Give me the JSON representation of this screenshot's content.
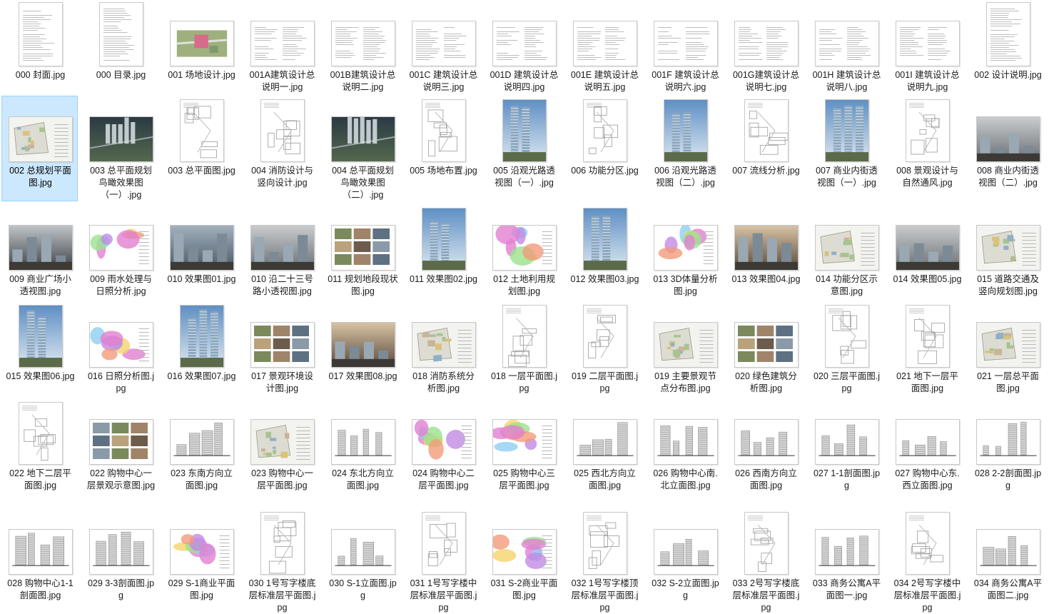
{
  "files": [
    {
      "name": "000 封面.jpg",
      "kind": "doc"
    },
    {
      "name": "000 目录.jpg",
      "kind": "doc"
    },
    {
      "name": "001 场地设计.jpg",
      "kind": "site"
    },
    {
      "name": "001A建筑设计总说明一.jpg",
      "kind": "spec"
    },
    {
      "name": "001B建筑设计总说明二.jpg",
      "kind": "spec"
    },
    {
      "name": "001C 建筑设计总说明三.jpg",
      "kind": "spec"
    },
    {
      "name": "001D 建筑设计总说明四.jpg",
      "kind": "spec"
    },
    {
      "name": "001E 建筑设计总说明五.jpg",
      "kind": "spec"
    },
    {
      "name": "001F 建筑设计总说明六.jpg",
      "kind": "spec"
    },
    {
      "name": "001G建筑设计总说明七.jpg",
      "kind": "spec"
    },
    {
      "name": "001H 建筑设计总说明八.jpg",
      "kind": "spec"
    },
    {
      "name": "001I 建筑设计总说明九.jpg",
      "kind": "spec"
    },
    {
      "name": "002 设计说明.jpg",
      "kind": "doc"
    },
    {
      "name": "002 总规划平面图.jpg",
      "kind": "plan",
      "selected": true
    },
    {
      "name": "003 总平面规划鸟瞰效果图（一）.jpg",
      "kind": "aerial"
    },
    {
      "name": "003 总平面图.jpg",
      "kind": "sheet"
    },
    {
      "name": "004 消防设计与竖向设计.jpg",
      "kind": "sheet"
    },
    {
      "name": "004 总平面规划鸟瞰效果图（二）.jpg",
      "kind": "aerial"
    },
    {
      "name": "005 场地布置.jpg",
      "kind": "sheet"
    },
    {
      "name": "005 沿观光路透视图（一）.jpg",
      "kind": "tower"
    },
    {
      "name": "006 功能分区.jpg",
      "kind": "sheet"
    },
    {
      "name": "006 沿观光路透视图（二）.jpg",
      "kind": "tower"
    },
    {
      "name": "007 流线分析.jpg",
      "kind": "sheet"
    },
    {
      "name": "007 商业内街透视图（一）.jpg",
      "kind": "tower"
    },
    {
      "name": "008 景观设计与自然通风.jpg",
      "kind": "sheet"
    },
    {
      "name": "008 商业内街透视图（二）.jpg",
      "kind": "render"
    },
    {
      "name": "009 商业广场小透视图.jpg",
      "kind": "render"
    },
    {
      "name": "009 雨水处理与日照分析.jpg",
      "kind": "color"
    },
    {
      "name": "010 效果图01.jpg",
      "kind": "render"
    },
    {
      "name": "010 沿二十三号路小透视图.jpg",
      "kind": "render"
    },
    {
      "name": "011 规划地段现状图.jpg",
      "kind": "photos"
    },
    {
      "name": "011 效果图02.jpg",
      "kind": "tower"
    },
    {
      "name": "012 土地利用规划图.jpg",
      "kind": "color"
    },
    {
      "name": "012 效果图03.jpg",
      "kind": "tower"
    },
    {
      "name": "013 3D体量分析图.jpg",
      "kind": "color"
    },
    {
      "name": "013 效果图04.jpg",
      "kind": "render"
    },
    {
      "name": "014 功能分区示意图.jpg",
      "kind": "plan"
    },
    {
      "name": "014 效果图05.jpg",
      "kind": "render"
    },
    {
      "name": "015 道路交通及竖向规划图.jpg",
      "kind": "plan"
    },
    {
      "name": "015 效果图06.jpg",
      "kind": "tower"
    },
    {
      "name": "016 日照分析图.jpg",
      "kind": "color"
    },
    {
      "name": "016 效果图07.jpg",
      "kind": "tower"
    },
    {
      "name": "017 景观环境设计图.jpg",
      "kind": "photos"
    },
    {
      "name": "017 效果图08.jpg",
      "kind": "render"
    },
    {
      "name": "018 消防系统分析图.jpg",
      "kind": "plan"
    },
    {
      "name": "018 一层平面图.jpg",
      "kind": "sheet"
    },
    {
      "name": "019 二层平面图.jpg",
      "kind": "sheet"
    },
    {
      "name": "019 主要景观节点分布图.jpg",
      "kind": "plan"
    },
    {
      "name": "020 绿色建筑分析图.jpg",
      "kind": "photos"
    },
    {
      "name": "020 三层平面图.jpg",
      "kind": "sheet"
    },
    {
      "name": "021 地下一层平面图.jpg",
      "kind": "sheet"
    },
    {
      "name": "021 一层总平面图.jpg",
      "kind": "plan"
    },
    {
      "name": "022 地下二层平面图.jpg",
      "kind": "sheet"
    },
    {
      "name": "022 购物中心一层景观示意图.jpg",
      "kind": "photos"
    },
    {
      "name": "023 东南方向立面图.jpg",
      "kind": "elev"
    },
    {
      "name": "023 购物中心一层平面图.jpg",
      "kind": "plan"
    },
    {
      "name": "024 东北方向立面图.jpg",
      "kind": "elev"
    },
    {
      "name": "024 购物中心二层平面图.jpg",
      "kind": "color"
    },
    {
      "name": "025 购物中心三层平面图.jpg",
      "kind": "color"
    },
    {
      "name": "025 西北方向立面图.jpg",
      "kind": "elev"
    },
    {
      "name": "026 购物中心南.北立面图.jpg",
      "kind": "elev"
    },
    {
      "name": "026 西南方向立面图.jpg",
      "kind": "elev"
    },
    {
      "name": "027 1-1剖面图.jpg",
      "kind": "elev"
    },
    {
      "name": "027 购物中心东.西立面图.jpg",
      "kind": "elev"
    },
    {
      "name": "028 2-2剖面图.jpg",
      "kind": "elev"
    },
    {
      "name": "028 购物中心1-1剖面图.jpg",
      "kind": "elev"
    },
    {
      "name": "029 3-3剖面图.jpg",
      "kind": "elev"
    },
    {
      "name": "029 S-1商业平面图.jpg",
      "kind": "color"
    },
    {
      "name": "030 1号写字楼底层标准层平面图.jpg",
      "kind": "sheet"
    },
    {
      "name": "030 S-1立面图.jpg",
      "kind": "elev"
    },
    {
      "name": "031 1号写字楼中层标准层平面图.jpg",
      "kind": "sheet"
    },
    {
      "name": "031 S-2商业平面图.jpg",
      "kind": "color"
    },
    {
      "name": "032 1号写字楼顶层标准层平面图.jpg",
      "kind": "sheet"
    },
    {
      "name": "032 S-2立面图.jpg",
      "kind": "elev"
    },
    {
      "name": "033 2号写字楼底层标准层平面图.jpg",
      "kind": "sheet"
    },
    {
      "name": "033 商务公寓A平面图一.jpg",
      "kind": "elev"
    },
    {
      "name": "034 2号写字楼中层标准层平面图.jpg",
      "kind": "sheet"
    },
    {
      "name": "034 商务公寓A平面图二.jpg",
      "kind": "elev"
    }
  ]
}
